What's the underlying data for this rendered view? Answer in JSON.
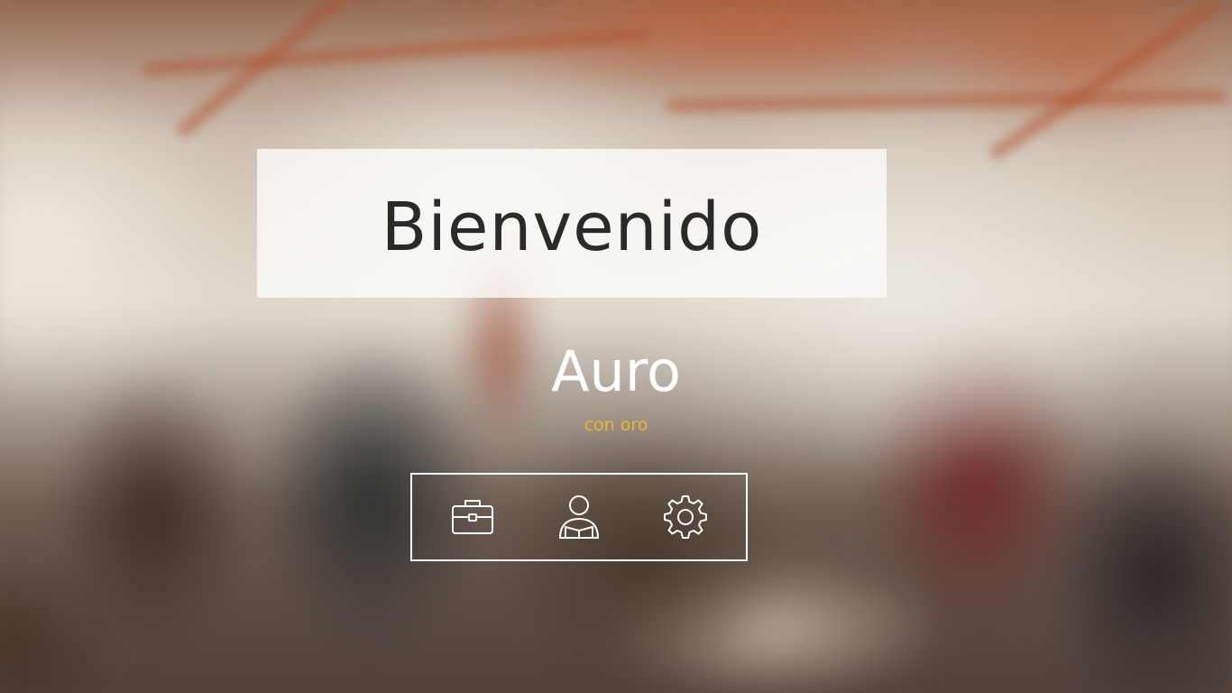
{
  "welcome": {
    "title": "Bienvenido"
  },
  "brand": {
    "name": "Auro",
    "tagline": "con oro",
    "tagline_color": "#e8b62f"
  },
  "menu": {
    "items": [
      {
        "icon": "briefcase-icon"
      },
      {
        "icon": "reader-icon"
      },
      {
        "icon": "gear-icon"
      }
    ]
  },
  "colors": {
    "panel": "rgba(255,255,255,0.74)",
    "text_dark": "#2a2a2a",
    "text_light": "#ffffff"
  }
}
